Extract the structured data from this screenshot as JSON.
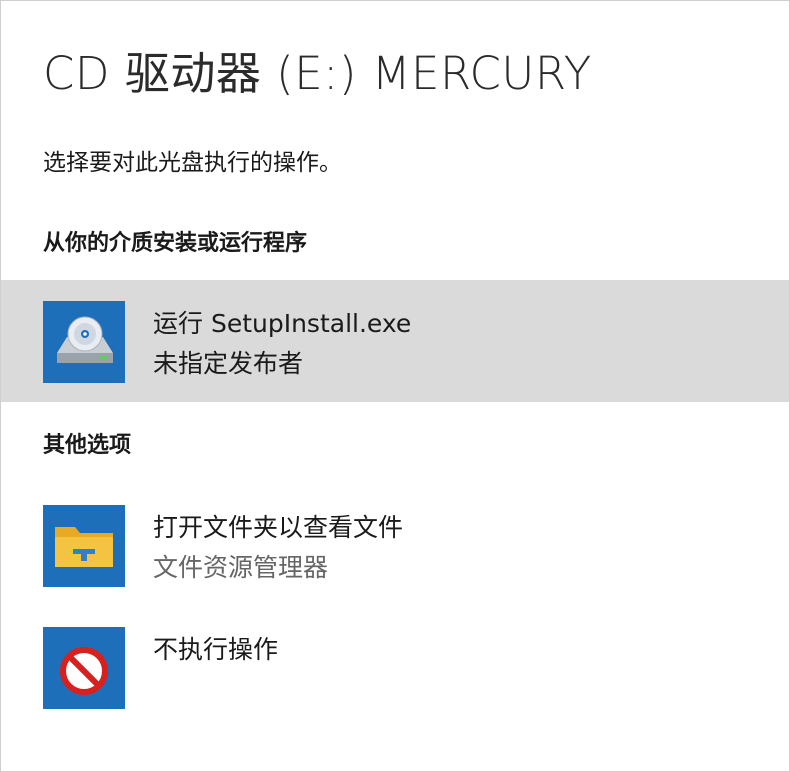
{
  "dialog": {
    "title": "CD 驱动器 (E:) MERCURY",
    "prompt": "选择要对此光盘执行的操作。"
  },
  "sections": {
    "install": {
      "heading": "从你的介质安装或运行程序",
      "option": {
        "title": "运行 SetupInstall.exe",
        "subtitle": "未指定发布者",
        "icon": "cd-drive-icon",
        "highlighted": true
      }
    },
    "other": {
      "heading": "其他选项",
      "options": [
        {
          "title": "打开文件夹以查看文件",
          "subtitle": "文件资源管理器",
          "icon": "file-explorer-folder-icon"
        },
        {
          "title": "不执行操作",
          "icon": "no-action-icon"
        }
      ]
    }
  },
  "colors": {
    "tile_blue": "#1e6fb9",
    "highlight_gray": "#dadada",
    "folder_yellow": "#f5c342",
    "no_action_red": "#d8201e"
  }
}
